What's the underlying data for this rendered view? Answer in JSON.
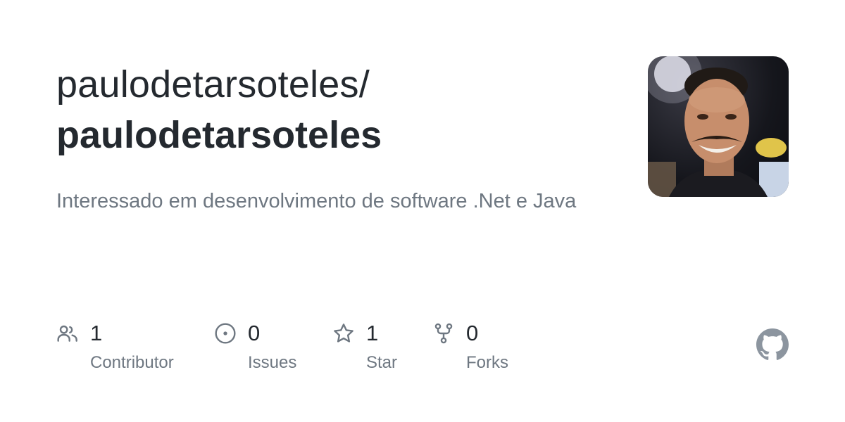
{
  "repo": {
    "owner_path": "paulodetarsoteles/",
    "name": "paulodetarsoteles",
    "description": "Interessado em desenvolvimento de software .Net e Java"
  },
  "avatar": {
    "alt": "owner avatar photo"
  },
  "stats": {
    "contributors": {
      "count": "1",
      "label": "Contributor",
      "icon": "people-icon"
    },
    "issues": {
      "count": "0",
      "label": "Issues",
      "icon": "issue-opened-icon"
    },
    "stars": {
      "count": "1",
      "label": "Star",
      "icon": "star-icon"
    },
    "forks": {
      "count": "0",
      "label": "Forks",
      "icon": "repo-forked-icon"
    }
  },
  "colors": {
    "title": "#24292f",
    "muted": "#6e7781",
    "logo": "#8c959f"
  }
}
